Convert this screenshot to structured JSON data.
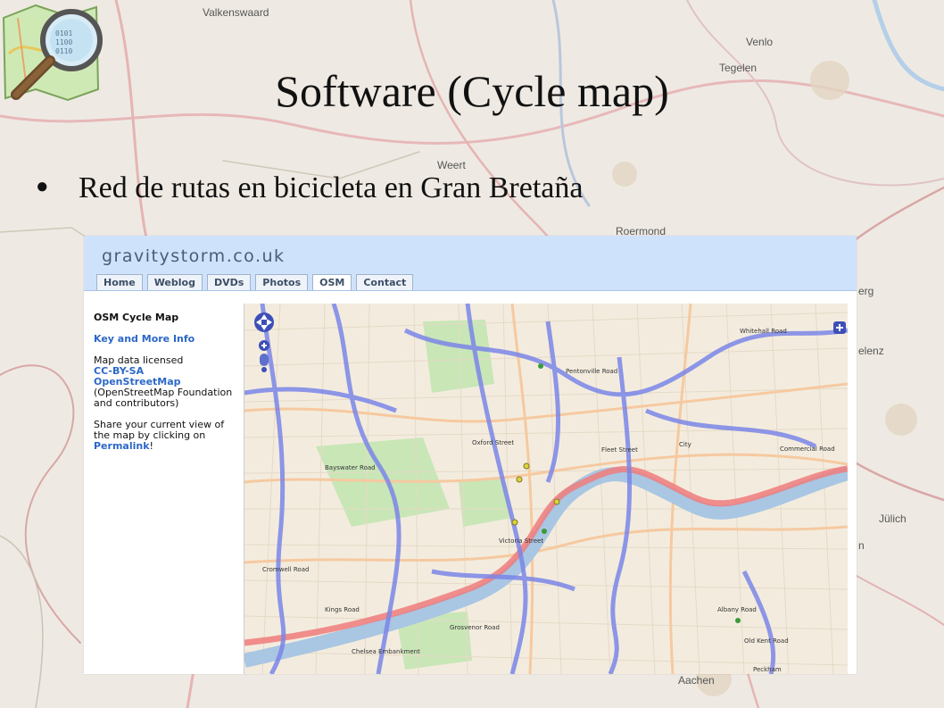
{
  "slide": {
    "title": "Software (Cycle map)",
    "bullet": "Red de rutas en bicicleta en Gran Bretaña"
  },
  "background_map": {
    "place_labels": [
      "Valkenswaard",
      "Venlo",
      "Tegelen",
      "Weert",
      "Roermond",
      "erg",
      "elenz",
      "Jülich",
      "n",
      "Aachen"
    ]
  },
  "site": {
    "title": "gravitystorm.co.uk",
    "nav": [
      "Home",
      "Weblog",
      "DVDs",
      "Photos",
      "OSM",
      "Contact"
    ],
    "active_tab": "OSM"
  },
  "sidebar": {
    "heading": "OSM Cycle Map",
    "key_link": "Key and More Info",
    "license_text": "Map data licensed",
    "license_link": "CC-BY-SA",
    "osm_link": "OpenStreetMap",
    "license_rest_1": "(OpenStreetMap Foundation",
    "license_rest_2": "and contributors)",
    "share_1": "Share your current view of",
    "share_2": "the map by clicking on",
    "permalink": "Permalink",
    "bang": "!"
  },
  "map": {
    "labels": [
      "City",
      "Whitehall Road",
      "Oxford Street",
      "Bayswater Road",
      "Victoria Street",
      "Chelsea Embankment",
      "Grosvenor Road",
      "Commercial Road",
      "Albany Road",
      "Old Kent Road",
      "Pentonville Road",
      "Cromwell Road",
      "Kings Road",
      "Fleet Street",
      "Peckham"
    ],
    "colors": {
      "base": "#f3ecde",
      "cycle_route": "#7b86e8",
      "national_route": "#ef7d7d",
      "park": "#c9e6b7",
      "water": "#a9c6e3"
    }
  },
  "colors": {
    "header_bg": "#cfe2fb",
    "link": "#2c68c8"
  }
}
